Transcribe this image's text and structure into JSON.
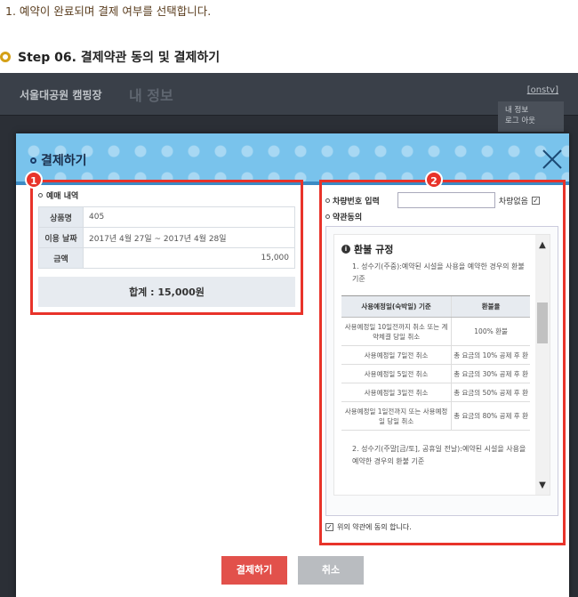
{
  "intro": "1. 예약이 완료되며 결제 여부를 선택합니다.",
  "step_title": "Step 06. 결제약관 동의 및 결제하기",
  "bg": {
    "brand": "서울대공원 캠핑장",
    "nav_item": "내 정보",
    "user": "[onstv]",
    "menu": [
      "내 정보",
      "로그 아웃"
    ]
  },
  "modal": {
    "title": "결제하기",
    "badges": [
      "1",
      "2"
    ],
    "left": {
      "section_label": "예매 내역",
      "rows": [
        {
          "label": "상품명",
          "value": "405"
        },
        {
          "label": "이용 날짜",
          "value": "2017년 4월 27일 ~ 2017년 4월 28일"
        },
        {
          "label": "금액",
          "value": "15,000"
        }
      ],
      "total": "합계 : 15,000원"
    },
    "right": {
      "car_label": "차량번호 입력",
      "car_none": "차량없음",
      "car_none_check": "✓",
      "terms_label": "약관동의",
      "refund_title": "환불 규정",
      "refund_icon": "i",
      "para1": "1. 성수기(주중):예약된 시설을 사용을 예약한 경우의 환불 기준",
      "table_head": [
        "사용예정일(숙박일) 기준",
        "환불율"
      ],
      "table_rows": [
        [
          "사용예정일 10일전까지 취소 또는 계약체결 당일 취소",
          "100% 환불"
        ],
        [
          "사용예정일 7일전 취소",
          "총 요금의 10% 공제 후 환"
        ],
        [
          "사용예정일 5일전 취소",
          "총 요금의 30% 공제 후 환"
        ],
        [
          "사용예정일 3일전 취소",
          "총 요금의 50% 공제 후 환"
        ],
        [
          "사용예정일 1일전까지 또는 사용예정일 당일 취소",
          "총 요금의 80% 공제 후 환"
        ]
      ],
      "para2": "2. 성수기(주말[금/토], 공휴일 전날):예약된 시설을 사용을 예약한 경우의 환불 기준",
      "agree_text": "위의 약관에 동의 합니다.",
      "agree_check": "✓"
    },
    "buttons": {
      "pay": "결제하기",
      "cancel": "취소"
    }
  },
  "colors": {
    "highlight": "#e8332a",
    "header": "#79c3ec",
    "pay": "#e2514b"
  },
  "icons": {
    "close": "close-icon",
    "scroll_up": "▲",
    "scroll_down": "▼"
  }
}
